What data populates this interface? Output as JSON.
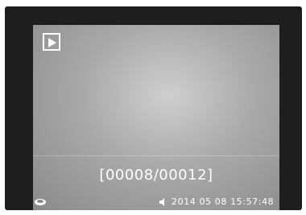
{
  "screen": {
    "mode_icon": "play-icon",
    "counter": "[00008/00012]",
    "timestamp": "2014 05 08  15:57:48",
    "corner_icon": "battery-icon",
    "status_icon": "audio-icon"
  },
  "colors": {
    "bezel": "#1e1e1e",
    "screen_center": "#cfcfcf",
    "screen_edge": "#8a8a8a",
    "osd_text": "#ffffff"
  }
}
